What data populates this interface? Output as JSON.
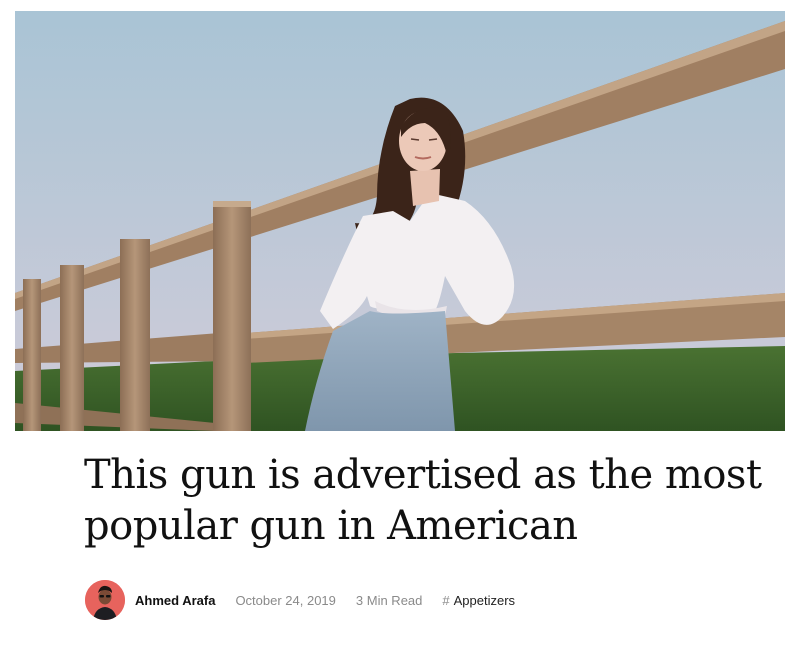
{
  "post": {
    "image_alt": "Woman leaning on a wooden fence in a field",
    "title": "This gun is advertised as the most popular gun in American",
    "author": "Ahmed Arafa",
    "date": "October 24, 2019",
    "read_time": "3 Min Read",
    "category_prefix": "#",
    "category": "Appetizers"
  },
  "colors": {
    "sky_top": "#a9c4d5",
    "sky_bottom": "#c9cbd8",
    "grass": "#3f6a2c",
    "wood": "#a88a6c",
    "avatar_bg": "#e7635d",
    "title_text": "#111111",
    "meta_text": "#8a8a8a"
  }
}
